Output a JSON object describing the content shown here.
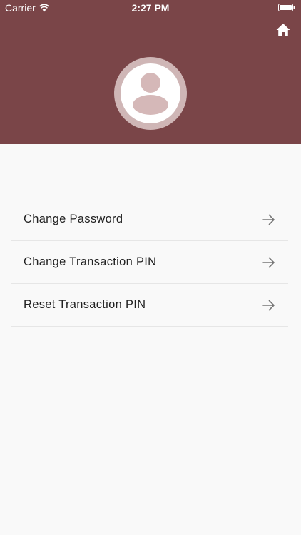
{
  "status_bar": {
    "carrier": "Carrier",
    "time": "2:27 PM",
    "wifi_icon": "wifi-icon",
    "battery_icon": "battery-icon"
  },
  "header": {
    "background": "#7a4548",
    "home_icon": "home-icon",
    "avatar_icon": "user-avatar-icon"
  },
  "menu": {
    "items": [
      {
        "label": "Change Password",
        "icon": "arrow-right-icon"
      },
      {
        "label": "Change Transaction PIN",
        "icon": "arrow-right-icon"
      },
      {
        "label": "Reset Transaction PIN",
        "icon": "arrow-right-icon"
      }
    ]
  }
}
